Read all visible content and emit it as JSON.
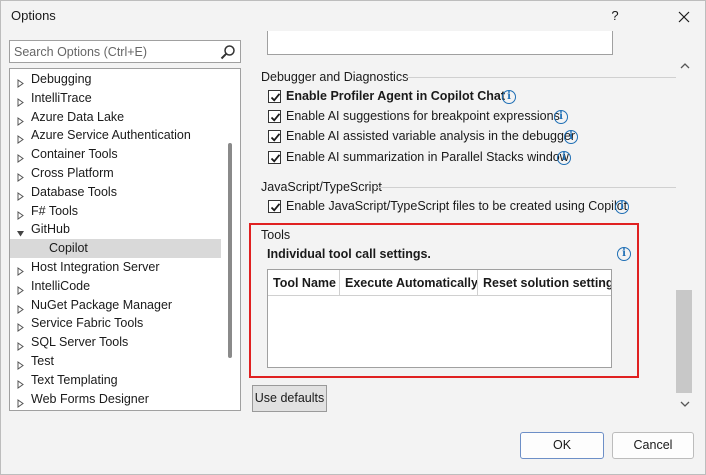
{
  "window": {
    "title": "Options",
    "help_label": "?"
  },
  "search": {
    "placeholder": "Search Options (Ctrl+E)"
  },
  "tree": {
    "items": [
      {
        "label": "Debugging",
        "expanded": false
      },
      {
        "label": "IntelliTrace",
        "expanded": false
      },
      {
        "label": "Azure Data Lake",
        "expanded": false
      },
      {
        "label": "Azure Service Authentication",
        "expanded": false
      },
      {
        "label": "Container Tools",
        "expanded": false
      },
      {
        "label": "Cross Platform",
        "expanded": false
      },
      {
        "label": "Database Tools",
        "expanded": false
      },
      {
        "label": "F# Tools",
        "expanded": false
      },
      {
        "label": "GitHub",
        "expanded": true
      },
      {
        "label": "Copilot",
        "child": true,
        "selected": true
      },
      {
        "label": "Host Integration Server",
        "expanded": false
      },
      {
        "label": "IntelliCode",
        "expanded": false
      },
      {
        "label": "NuGet Package Manager",
        "expanded": false
      },
      {
        "label": "Service Fabric Tools",
        "expanded": false
      },
      {
        "label": "SQL Server Tools",
        "expanded": false
      },
      {
        "label": "Test",
        "expanded": false
      },
      {
        "label": "Text Templating",
        "expanded": false
      },
      {
        "label": "Web Forms Designer",
        "expanded": false
      }
    ]
  },
  "debugger": {
    "title": "Debugger and Diagnostics",
    "options": [
      {
        "label": "Enable Profiler Agent in Copilot Chat",
        "checked": true,
        "bold": true
      },
      {
        "label": "Enable AI suggestions for breakpoint expressions",
        "checked": true
      },
      {
        "label": "Enable AI assisted variable analysis in the debugger",
        "checked": true
      },
      {
        "label": "Enable AI summarization in Parallel Stacks window",
        "checked": true
      }
    ]
  },
  "javascript": {
    "title": "JavaScript/TypeScript",
    "option": {
      "label": "Enable JavaScript/TypeScript files to be created using Copilot",
      "checked": true
    }
  },
  "tools": {
    "title": "Tools",
    "description": "Individual tool call settings.",
    "columns": [
      "Tool Name",
      "Execute Automatically",
      "Reset solution setting"
    ],
    "highlight_color": "#e02020"
  },
  "buttons": {
    "use_defaults": "Use defaults",
    "ok": "OK",
    "cancel": "Cancel"
  },
  "colors": {
    "info_blue": "#1f6fb5",
    "selected_bg": "#d9d9d9"
  }
}
